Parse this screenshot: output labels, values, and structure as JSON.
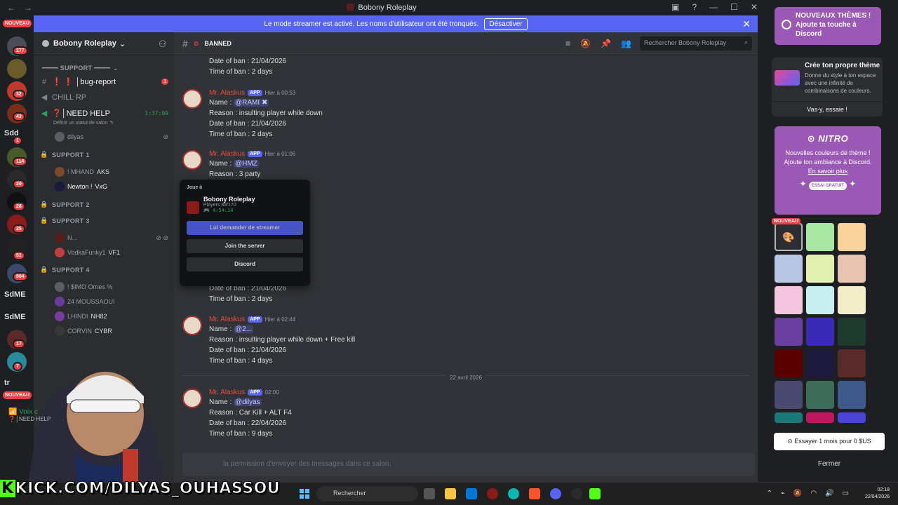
{
  "window": {
    "title": "Bobony Roleplay"
  },
  "rail": {
    "new_label": "NOUVEAU",
    "new_label2": "NOUVEAU",
    "badges": [
      "277",
      "32",
      "43",
      "1",
      "114",
      "20",
      "28",
      "25",
      "51",
      "804",
      "17",
      "7"
    ],
    "text_servers": [
      "Sdd",
      "SdME",
      "SdME",
      "tr"
    ]
  },
  "banner": {
    "text": "Le mode streamer est activé. Les noms d'utilisateur ont été tronqués.",
    "button": "Désactiver"
  },
  "guild": {
    "name": "Bobony Roleplay"
  },
  "channels": {
    "support_header": "━━━━ SUPPORT ━━━━",
    "bug_report": "❗ ❗ │bug-report",
    "bug_badge": "1",
    "chill": "CHILL RP",
    "need_help": "❓│NEED HELP",
    "need_help_timer": "1:37:09",
    "status_hint": "Définir un statut de salon",
    "dilyas": "dilyas",
    "support1": "SUPPORT 1",
    "s1_user1": "! MHAND",
    "s1_user1_tag": "AKS",
    "s1_user2": "Newton !",
    "s1_user2_tag": "VxG",
    "support2": "SUPPORT 2",
    "support3": "SUPPORT 3",
    "s3_user1": "N...",
    "s3_user2": "VodkaFunky1",
    "s3_user2_tag": "VF1",
    "support4": "SUPPORT 4",
    "s4_user1": "! $IMO Ornes %",
    "s4_user2": "24 MOUSSAOUI",
    "s4_user3": "LHINDI",
    "s4_user3_tag": "NH82",
    "s4_user4": "CORVIN",
    "s4_user4_tag": "CYBR",
    "voice_label": "Voix c",
    "voice_sub": "❓│NEED HELP"
  },
  "chat": {
    "channel_name": "BANNED",
    "search_placeholder": "Rechercher Bobony Roleplay",
    "author": "Mr. Alaskus",
    "app_tag": "APP",
    "top_lines": [
      "Date of ban : 21/04/2026",
      "Time of ban : 2 days"
    ],
    "messages": [
      {
        "time": "Hier à 00:53",
        "name_label": "Name :",
        "mention": "@RAMI ✖",
        "reason": "Reason : insulting player while down",
        "date": "Date of ban : 21/04/2026",
        "duration": "Time of ban : 2 days"
      },
      {
        "time": "Hier à 01:06",
        "name_label": "Name :",
        "mention": "@HMZ",
        "reason": "Reason : 3 party"
      },
      {
        "date": "Date of ban : 21/04/2026",
        "duration": "Time of ban : 2 days"
      },
      {
        "time": "Hier à 02:44",
        "name_label": "Name :",
        "mention": "@2...",
        "reason": "Reason : insulting player while down + Free kill",
        "date": "Date of ban : 21/04/2026",
        "duration": "Time of ban : 4 days"
      },
      {
        "time": "02:00",
        "name_label": "Name :",
        "mention": "@dilyas",
        "reason": "Reason : Car Kill + ALT F4",
        "date": "Date of ban : 22/04/2026",
        "duration": "Time of ban : 9 days"
      }
    ],
    "date_divider": "22 avril 2026",
    "composer": "la permission d'envoyer des messages dans ce salon."
  },
  "popup": {
    "label": "Joue à",
    "game": "Bobony Roleplay",
    "players": "Players 89/170",
    "elapsed": "4:54:14",
    "btn_streamer": "Lui demander de streamer",
    "btn_join": "Join the server",
    "btn_discord": "Discord"
  },
  "right": {
    "promo_title": "NOUVEAUX THÈMES ! Ajoute ta touche à Discord",
    "theme_title": "Crée ton propre thème",
    "theme_desc": "Donne du style à ton espace avec une infinité de combinaisons de couleurs.",
    "theme_btn": "Vas-y, essaie !",
    "nitro_logo": "NITRO",
    "nitro_text": "Nouvelles couleurs de thème ! Ajoute ton ambiance à Discord.",
    "nitro_link": "En savoir plus",
    "nitro_try": "ESSAI GRATUIT",
    "swatch_new": "NOUVEAU",
    "trial_button": "Essayer 1 mois pour 0 $US",
    "close_button": "Fermer",
    "swatch_colors": [
      "#a8e6a3",
      "#f9d29d",
      "#b9c6e4",
      "#e3f0b0",
      "#e8c4b0",
      "#f5c6e0",
      "#c8f0f0",
      "#f1edc9",
      "#6b3fa0",
      "#3b2ab8",
      "#1f3b2f",
      "#5a0000",
      "#1e1a3f",
      "#5a2a2a",
      "#4a4a70",
      "#3f6b5a",
      "#3e5a8a",
      "#1a7a7a",
      "#c01860",
      "#4b44d6"
    ]
  },
  "overlay": {
    "kick_url": "KICK.COM/DILYAS_OUHASSOU",
    "kick_k": "K"
  },
  "taskbar": {
    "search": "Rechercher",
    "time": "02:18",
    "date": "22/04/2026"
  }
}
